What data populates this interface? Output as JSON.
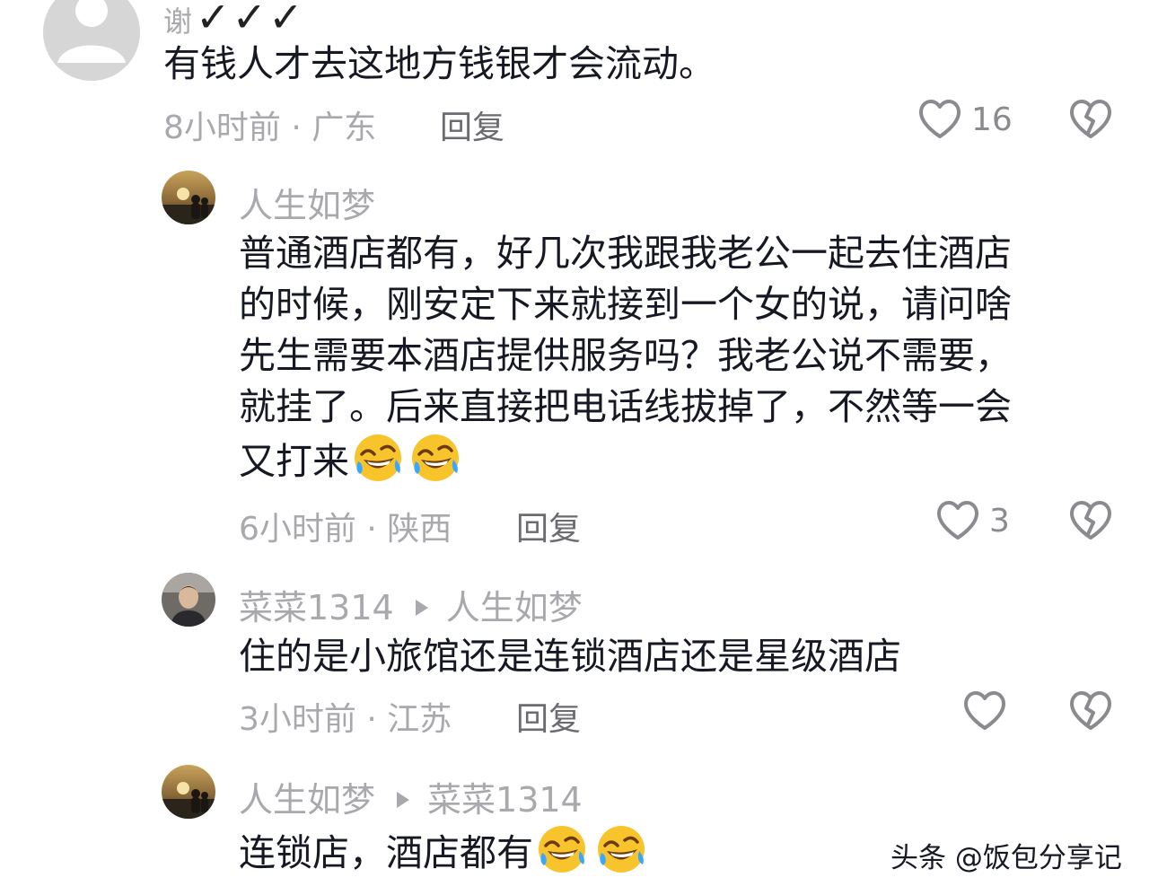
{
  "comments": [
    {
      "username_partial": "谢",
      "checks": "✓✓✓",
      "text": "有钱人才去这地方钱银才会流动。",
      "time": "8小时前",
      "location": "广东",
      "reply_label": "回复",
      "likes": "16"
    },
    {
      "username": "人生如梦",
      "lines": [
        "普通酒店都有，好几次我跟我老公一起去住酒店",
        "的时候，刚安定下来就接到一个女的说，请问啥",
        "先生需要本酒店提供服务吗？我老公说不需要，",
        "就挂了。后来直接把电话线拔掉了，不然等一会",
        "又打来"
      ],
      "emojis": [
        "rofl-emoji",
        "rofl-emoji"
      ],
      "time": "6小时前",
      "location": "陕西",
      "reply_label": "回复",
      "likes": "3"
    },
    {
      "username": "菜菜1314",
      "reply_to": "人生如梦",
      "text": "住的是小旅馆还是连锁酒店还是星级酒店",
      "time": "3小时前",
      "location": "江苏",
      "reply_label": "回复",
      "likes": ""
    },
    {
      "username": "人生如梦",
      "reply_to": "菜菜1314",
      "text": "连锁店，酒店都有",
      "emojis": [
        "rofl-emoji",
        "rofl-emoji"
      ]
    }
  ],
  "meta_separator": "·",
  "watermark": "头条 @饭包分享记",
  "colors": {
    "text": "#161823",
    "muted": "#a8a8ad",
    "icon": "#8a8a8f"
  }
}
